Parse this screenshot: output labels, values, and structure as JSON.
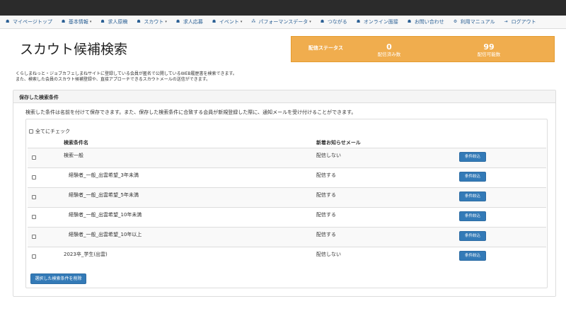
{
  "nav": {
    "items": [
      {
        "label": "マイページトップ",
        "icon": "home-icon",
        "glyph": "☗",
        "caret": false
      },
      {
        "label": "基本情報",
        "icon": "home-icon",
        "glyph": "☗",
        "caret": true
      },
      {
        "label": "求人原稿",
        "icon": "home-icon",
        "glyph": "☗",
        "caret": false
      },
      {
        "label": "スカウト",
        "icon": "home-icon",
        "glyph": "☗",
        "caret": true
      },
      {
        "label": "求人応募",
        "icon": "home-icon",
        "glyph": "☗",
        "caret": false
      },
      {
        "label": "イベント",
        "icon": "home-icon",
        "glyph": "☗",
        "caret": true
      },
      {
        "label": "パフォーマンスデータ",
        "icon": "sitemap-icon",
        "glyph": "⁂",
        "caret": true
      },
      {
        "label": "つながる",
        "icon": "home-icon",
        "glyph": "☗",
        "caret": false
      },
      {
        "label": "オンライン面接",
        "icon": "home-icon",
        "glyph": "☗",
        "caret": false
      },
      {
        "label": "お問い合わせ",
        "icon": "home-icon",
        "glyph": "☗",
        "caret": false
      },
      {
        "label": "利用マニュアル",
        "icon": "gear-icon",
        "glyph": "⚙",
        "caret": false
      },
      {
        "label": "ログアウト",
        "icon": "logout-icon",
        "glyph": "⇥",
        "caret": false
      }
    ],
    "caret_glyph": "▾"
  },
  "page": {
    "title": "スカウト候補検索",
    "description_1": "くらしまねっと・ジョブカフェしまねサイトに登録している会員が匿名で公開しているWEB履歴書を検索できます。",
    "description_2": "また、検索した会員のスカウト候補登録や、直接アプローチできるスカウトメールの送信ができます。"
  },
  "status": {
    "label": "配信ステータス",
    "sent_count": "0",
    "sent_label": "配信済み数",
    "available_count": "99",
    "available_label": "配信可能数",
    "color": "#f0ad4e"
  },
  "saved": {
    "heading": "保存した検索条件",
    "description": "検索した条件は名前を付けて保存できます。また、保存した検索条件に合致する会員が新規登録した際に、通知メールを受け付けることができます。",
    "check_all": "全てにチェック",
    "col_name": "検索条件名",
    "col_mail": "新着お知らせメール",
    "rows": [
      {
        "name": "検索一般",
        "mail": "配信しない",
        "button": "条件絞込"
      },
      {
        "name": "経験者_一般_出雲希望_3年未満",
        "mail": "配信する",
        "button": "条件絞込"
      },
      {
        "name": "経験者_一般_出雲希望_5年未満",
        "mail": "配信する",
        "button": "条件絞込"
      },
      {
        "name": "経験者_一般_出雲希望_10年未満",
        "mail": "配信する",
        "button": "条件絞込"
      },
      {
        "name": "経験者_一般_出雲希望_10年以上",
        "mail": "配信する",
        "button": "条件絞込"
      },
      {
        "name": "2023卒_学生(出雲)",
        "mail": "配信しない",
        "button": "条件絞込"
      }
    ],
    "delete_button": "選択した検索条件を削除",
    "button_color": "#337ab7"
  }
}
